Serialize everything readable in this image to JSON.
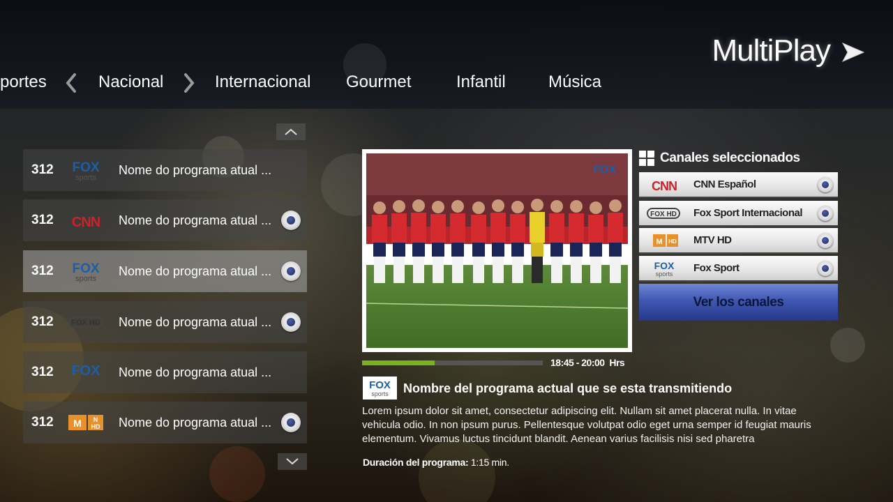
{
  "app": {
    "logo_text": "MultiPlay"
  },
  "nav": {
    "items": [
      "portes",
      "Nacional",
      "Internacional",
      "Gourmet",
      "Infantil",
      "Música"
    ]
  },
  "channel_list": {
    "rows": [
      {
        "number": "312",
        "channel_logo": "FOX sports",
        "program": "Nome do programa atual ...",
        "selected": false,
        "has_radio": false
      },
      {
        "number": "312",
        "channel_logo": "CNN",
        "program": "Nome do programa atual ...",
        "selected": false,
        "has_radio": true
      },
      {
        "number": "312",
        "channel_logo": "FOX sports",
        "program": "Nome do programa atual ...",
        "selected": true,
        "has_radio": true
      },
      {
        "number": "312",
        "channel_logo": "FOX HD",
        "program": "Nome do programa atual ...",
        "selected": false,
        "has_radio": true
      },
      {
        "number": "312",
        "channel_logo": "FOX",
        "program": "Nome do programa atual ...",
        "selected": false,
        "has_radio": false
      },
      {
        "number": "312",
        "channel_logo": "MTV NHD",
        "program": "Nome do programa atual ...",
        "selected": false,
        "has_radio": true
      }
    ]
  },
  "player": {
    "watermark": "FOX",
    "progress": 0.4,
    "time_range": "18:45 - 20:00",
    "time_unit": "Hrs"
  },
  "program": {
    "logo_text_1": "FOX",
    "logo_text_2": "sports",
    "title": "Nombre del programa actual que se esta transmitiendo",
    "description": "Lorem ipsum dolor sit amet, consectetur adipiscing elit. Nullam sit amet placerat nulla. In vitae vehicula odio. In non ipsum purus. Pellentesque volutpat odio eget urna semper id feugiat mauris elementum. Vivamus luctus tincidunt blandit. Aenean varius facilisis nisi sed pharetra",
    "duration_label": "Duración del programa:",
    "duration_value": "1:15 min."
  },
  "selected_channels": {
    "header": "Canales seleccionados",
    "items": [
      {
        "name": "CNN Español",
        "logo": "CNN"
      },
      {
        "name": "Fox Sport Internacional",
        "logo": "FOX HD"
      },
      {
        "name": "MTV HD",
        "logo": "MTV HD"
      },
      {
        "name": "Fox Sport",
        "logo": "FOX sports"
      }
    ],
    "button_label": "Ver los canales"
  },
  "colors": {
    "progress_fill": "#7ab21e",
    "button_blue": "#3f58b3",
    "fox_blue": "#1a5fa8",
    "cnn_red": "#cc2229",
    "mtv_orange": "#e8912b"
  }
}
